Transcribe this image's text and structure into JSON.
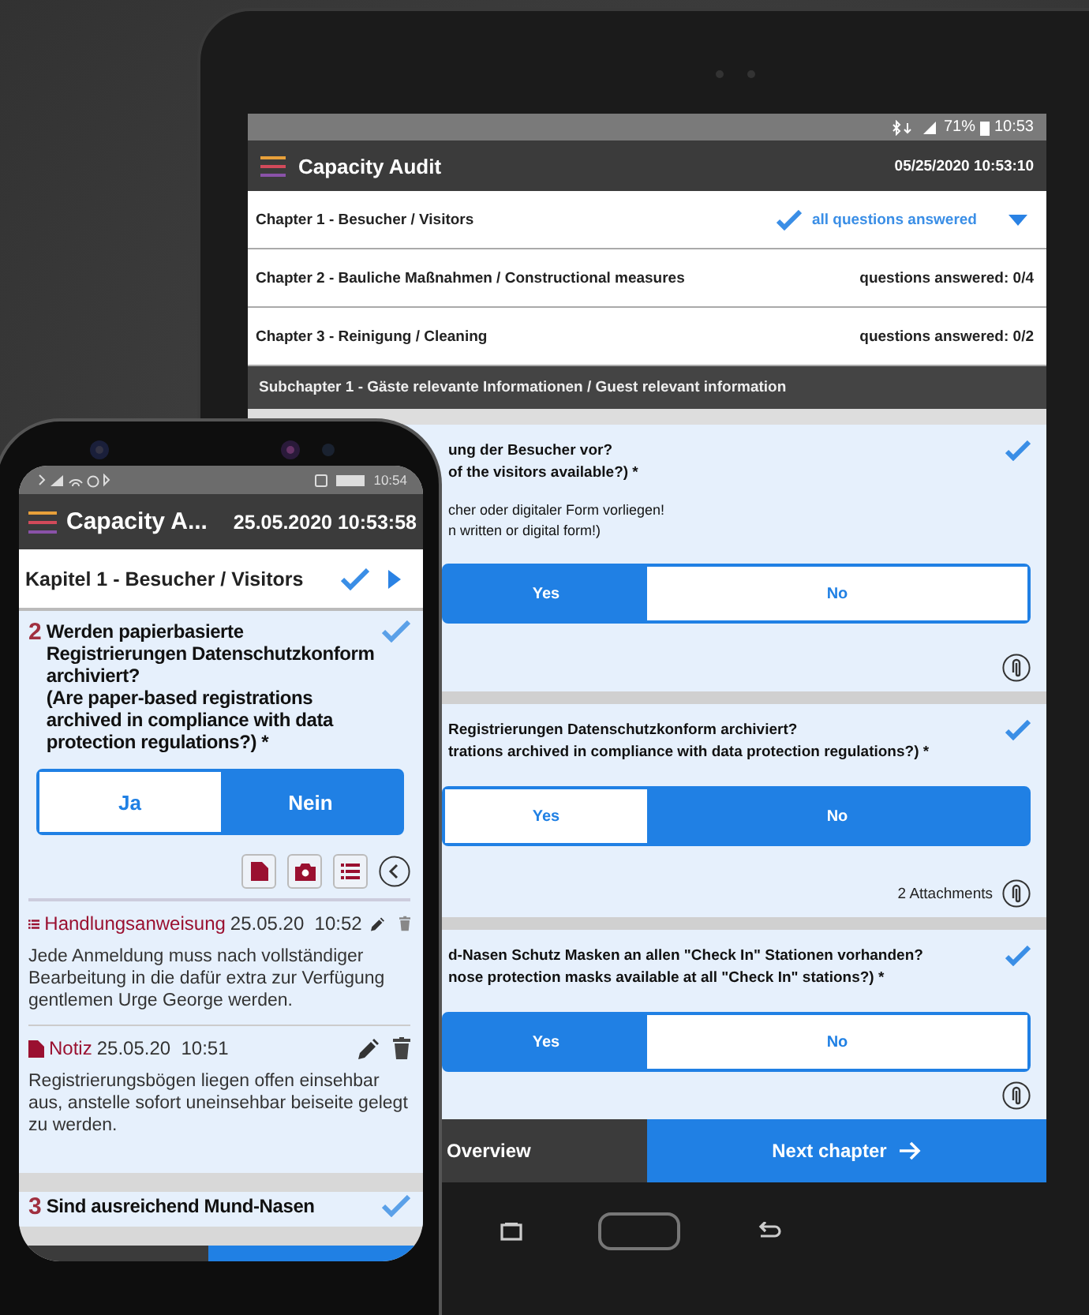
{
  "tablet": {
    "status_bar": {
      "battery": "71%",
      "time": "10:53"
    },
    "app_bar": {
      "title": "Capacity Audit",
      "datetime": "05/25/2020 10:53:10"
    },
    "chapters": [
      {
        "title": "Chapter 1 - Besucher / Visitors",
        "status": "all questions answered",
        "complete": true,
        "expanded": true
      },
      {
        "title": "Chapter 2 - Bauliche Maßnahmen / Constructional measures",
        "status": "questions answered: 0/4",
        "complete": false,
        "expanded": false
      },
      {
        "title": "Chapter 3 - Reinigung / Cleaning",
        "status": "questions answered: 0/2",
        "complete": false,
        "expanded": false
      }
    ],
    "subchapter": "Subchapter 1 - Gäste relevante Informationen / Guest relevant information",
    "questions": [
      {
        "lines": [
          "ung der Besucher vor?",
          "of the visitors available?)  *"
        ],
        "hint_lines": [
          "cher oder digitaler Form vorliegen!",
          "n written or digital form!)"
        ],
        "answered": true,
        "options": [
          {
            "label": "Yes",
            "selected": true
          },
          {
            "label": "No",
            "selected": false
          }
        ]
      },
      {
        "lines": [
          "Registrierungen Datenschutzkonform archiviert?",
          "trations archived in compliance with data protection regulations?)  *"
        ],
        "answered": true,
        "options": [
          {
            "label": "Yes",
            "selected": false
          },
          {
            "label": "No",
            "selected": true
          }
        ],
        "attachments": "2 Attachments"
      },
      {
        "lines": [
          "d-Nasen Schutz Masken an allen \"Check In\" Stationen vorhanden?",
          "nose protection masks available at all \"Check In\" stations?)  *"
        ],
        "answered": true,
        "options": [
          {
            "label": "Yes",
            "selected": true
          },
          {
            "label": "No",
            "selected": false
          }
        ]
      }
    ],
    "footer": {
      "overview": "Overview",
      "next": "Next chapter"
    }
  },
  "phone": {
    "status_bar": {
      "time": "10:54"
    },
    "app_bar": {
      "title": "Capacity A...",
      "datetime": "25.05.2020 10:53:58"
    },
    "chapter": {
      "title": "Kapitel 1 - Besucher / Visitors",
      "complete": true
    },
    "questions": [
      {
        "number": "2",
        "lines": [
          "Werden papierbasierte Registrierungen Datenschutzkonform archiviert?",
          "(Are paper-based registrations archived in compliance with data protection regulations?)  *"
        ],
        "answered": true,
        "options": [
          {
            "label": "Ja",
            "selected": false
          },
          {
            "label": "Nein",
            "selected": true
          }
        ],
        "entries": [
          {
            "kind": "instruction",
            "label": "Handlungsanweisung",
            "date": "25.05.20  10:52",
            "text": "Jede Anmeldung muss nach vollständiger Bearbeitung in die dafür extra zur Verfügung gentlemen Urge George werden."
          },
          {
            "kind": "note",
            "label": "Notiz",
            "date": "25.05.20  10:51",
            "text": "Registrierungsbögen liegen offen einsehbar aus, anstelle sofort uneinsehbar beiseite gelegt zu werden."
          }
        ]
      },
      {
        "number": "3",
        "lines": [
          "Sind ausreichend Mund-Nasen"
        ],
        "answered": true
      }
    ]
  }
}
